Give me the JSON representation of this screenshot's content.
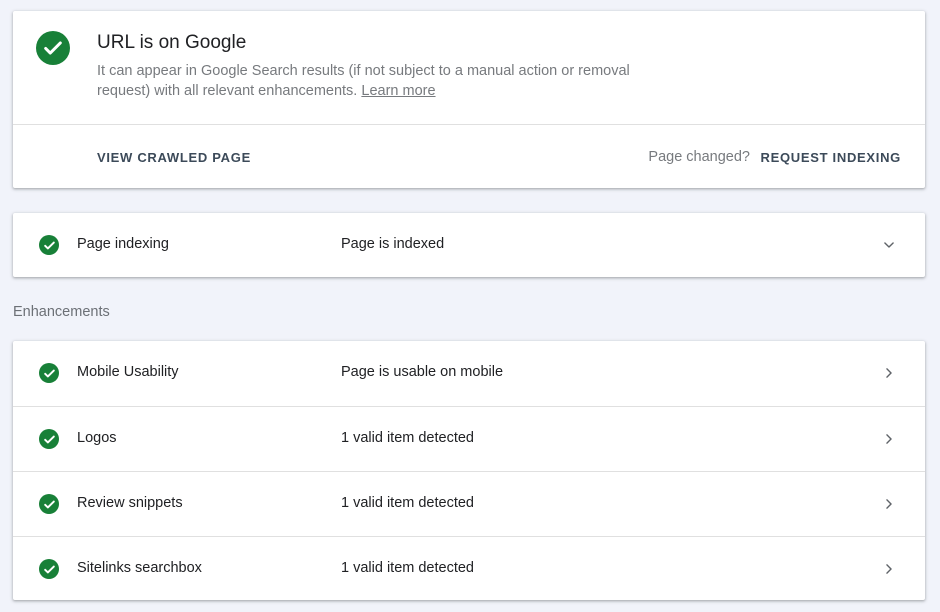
{
  "status": {
    "title": "URL is on Google",
    "description": "It can appear in Google Search results (if not subject to a manual action or removal request) with all relevant enhancements.",
    "learn_more": "Learn more",
    "view_crawled_label": "VIEW CRAWLED PAGE",
    "page_changed": "Page changed?",
    "request_indexing_label": "REQUEST INDEXING",
    "status_color": "#188038"
  },
  "indexing": {
    "label": "Page indexing",
    "value": "Page is indexed",
    "icon": "chevron-down-icon"
  },
  "enhancements": {
    "heading": "Enhancements",
    "items": [
      {
        "label": "Mobile Usability",
        "value": "Page is usable on mobile"
      },
      {
        "label": "Logos",
        "value": "1 valid item detected"
      },
      {
        "label": "Review snippets",
        "value": "1 valid item detected"
      },
      {
        "label": "Sitelinks searchbox",
        "value": "1 valid item detected"
      }
    ],
    "icon": "chevron-right-icon"
  }
}
